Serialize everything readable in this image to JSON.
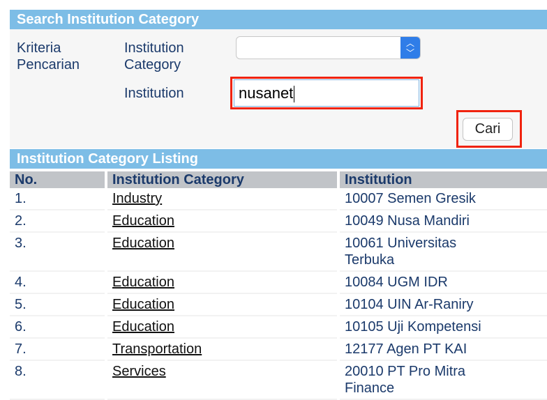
{
  "search": {
    "title": "Search Institution Category",
    "criteria_label": "Kriteria Pencarian",
    "category_label": "Institution Category",
    "category_value": "",
    "institution_label": "Institution",
    "institution_value": "nusanet",
    "submit": "Cari"
  },
  "listing": {
    "title": "Institution Category Listing",
    "columns": [
      "No.",
      "Institution Category",
      "Institution"
    ],
    "rows": [
      {
        "no": "1.",
        "category": "Industry",
        "institution": "10007 Semen Gresik"
      },
      {
        "no": "2.",
        "category": "Education",
        "institution": "10049 Nusa Mandiri"
      },
      {
        "no": "3.",
        "category": "Education",
        "institution": "10061 Universitas Terbuka"
      },
      {
        "no": "4.",
        "category": "Education",
        "institution": "10084 UGM IDR"
      },
      {
        "no": "5.",
        "category": "Education",
        "institution": "10104 UIN Ar-Raniry"
      },
      {
        "no": "6.",
        "category": "Education",
        "institution": "10105 Uji Kompetensi"
      },
      {
        "no": "7.",
        "category": "Transportation",
        "institution": "12177 Agen PT KAI"
      },
      {
        "no": "8.",
        "category": "Services",
        "institution": "20010 PT Pro Mitra Finance"
      }
    ]
  },
  "colors": {
    "header": "#7dbde6",
    "highlight": "#f0230e",
    "text": "#1b3a6b"
  }
}
